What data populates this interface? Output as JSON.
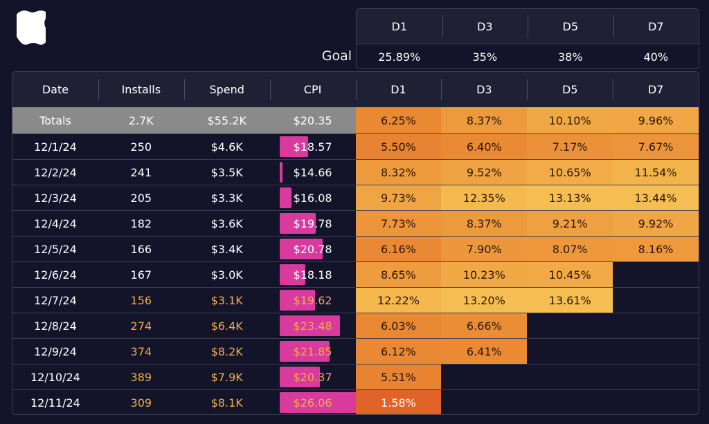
{
  "header": {
    "logo_icon": "apple-icon",
    "goal_label": "Goal"
  },
  "goal": {
    "columns": [
      "D1",
      "D3",
      "D5",
      "D7"
    ],
    "values": [
      "25.89%",
      "35%",
      "38%",
      "40%"
    ]
  },
  "colors": {
    "background": "#13142a",
    "header_bg": "#1f2034",
    "totals_bg": "#8a8a8a",
    "cpi_bar": "#d93a9e",
    "highlight_text": "#f0ab4c",
    "retention_low": "#e0622a",
    "retention_high": "#f5be52"
  },
  "table": {
    "columns": [
      "Date",
      "Installs",
      "Spend",
      "CPI",
      "D1",
      "D3",
      "D5",
      "D7"
    ],
    "totals": {
      "date": "Totals",
      "installs": "2.7K",
      "spend": "$55.2K",
      "cpi": "$20.35",
      "d1": "6.25%",
      "d3": "8.37%",
      "d5": "10.10%",
      "d7": "9.96%"
    },
    "rows": [
      {
        "date": "12/1/24",
        "installs": "250",
        "spend": "$4.6K",
        "cpi": "$18.57",
        "cpi_value": 18.57,
        "highlight": false,
        "d1": "5.50%",
        "d3": "6.40%",
        "d5": "7.17%",
        "d7": "7.67%"
      },
      {
        "date": "12/2/24",
        "installs": "241",
        "spend": "$3.5K",
        "cpi": "$14.66",
        "cpi_value": 14.66,
        "highlight": false,
        "d1": "8.32%",
        "d3": "9.52%",
        "d5": "10.65%",
        "d7": "11.54%"
      },
      {
        "date": "12/3/24",
        "installs": "205",
        "spend": "$3.3K",
        "cpi": "$16.08",
        "cpi_value": 16.08,
        "highlight": false,
        "d1": "9.73%",
        "d3": "12.35%",
        "d5": "13.13%",
        "d7": "13.44%"
      },
      {
        "date": "12/4/24",
        "installs": "182",
        "spend": "$3.6K",
        "cpi": "$19.78",
        "cpi_value": 19.78,
        "highlight": false,
        "d1": "7.73%",
        "d3": "8.37%",
        "d5": "9.21%",
        "d7": "9.92%"
      },
      {
        "date": "12/5/24",
        "installs": "166",
        "spend": "$3.4K",
        "cpi": "$20.78",
        "cpi_value": 20.78,
        "highlight": false,
        "d1": "6.16%",
        "d3": "7.90%",
        "d5": "8.07%",
        "d7": "8.16%"
      },
      {
        "date": "12/6/24",
        "installs": "167",
        "spend": "$3.0K",
        "cpi": "$18.18",
        "cpi_value": 18.18,
        "highlight": false,
        "d1": "8.65%",
        "d3": "10.23%",
        "d5": "10.45%",
        "d7": null
      },
      {
        "date": "12/7/24",
        "installs": "156",
        "spend": "$3.1K",
        "cpi": "$19.62",
        "cpi_value": 19.62,
        "highlight": true,
        "d1": "12.22%",
        "d3": "13.20%",
        "d5": "13.61%",
        "d7": null
      },
      {
        "date": "12/8/24",
        "installs": "274",
        "spend": "$6.4K",
        "cpi": "$23.48",
        "cpi_value": 23.48,
        "highlight": true,
        "d1": "6.03%",
        "d3": "6.66%",
        "d5": null,
        "d7": null
      },
      {
        "date": "12/9/24",
        "installs": "374",
        "spend": "$8.2K",
        "cpi": "$21.85",
        "cpi_value": 21.85,
        "highlight": true,
        "d1": "6.12%",
        "d3": "6.41%",
        "d5": null,
        "d7": null
      },
      {
        "date": "12/10/24",
        "installs": "389",
        "spend": "$7.9K",
        "cpi": "$20.37",
        "cpi_value": 20.37,
        "highlight": true,
        "d1": "5.51%",
        "d3": null,
        "d5": null,
        "d7": null
      },
      {
        "date": "12/11/24",
        "installs": "309",
        "spend": "$8.1K",
        "cpi": "$26.06",
        "cpi_value": 26.06,
        "highlight": true,
        "d1": "1.58%",
        "d3": null,
        "d5": null,
        "d7": null
      }
    ]
  }
}
